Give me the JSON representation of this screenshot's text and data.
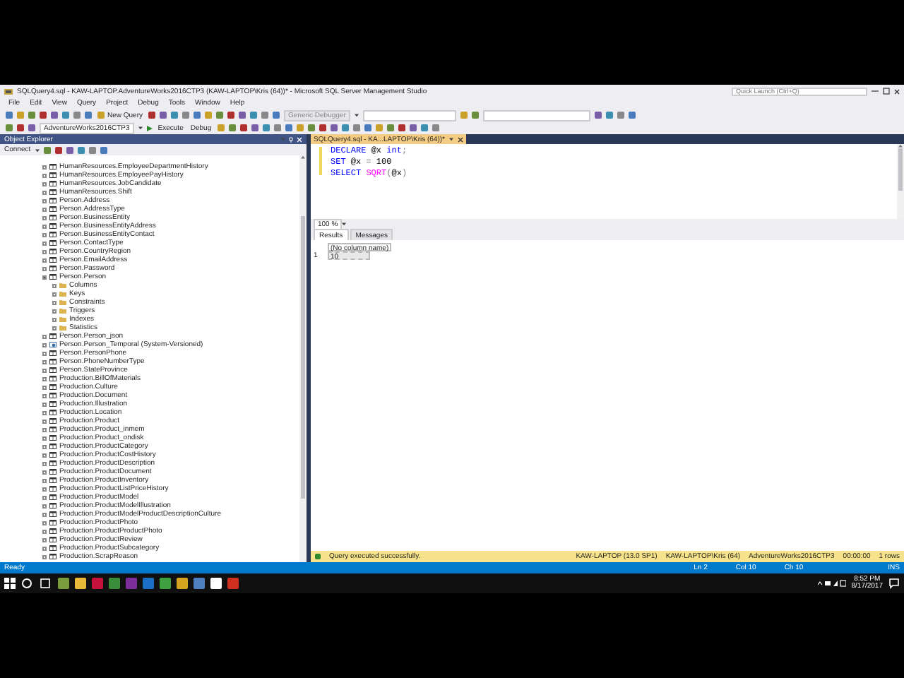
{
  "window": {
    "title": "SQLQuery4.sql - KAW-LAPTOP.AdventureWorks2016CTP3 (KAW-LAPTOP\\Kris (64))* - Microsoft SQL Server Management Studio",
    "quick_launch": {
      "placeholder": "Quick Launch (Ctrl+Q)"
    }
  },
  "menu": [
    "File",
    "Edit",
    "View",
    "Query",
    "Project",
    "Debug",
    "Tools",
    "Window",
    "Help"
  ],
  "toolbar": {
    "new_query": "New Query",
    "database": "AdventureWorks2016CTP3",
    "execute": "Execute",
    "debug": "Debug",
    "debugger": "Generic Debugger"
  },
  "object_explorer": {
    "title": "Object Explorer",
    "connect": "Connect",
    "tree": [
      {
        "label": "HumanResources.EmployeeDepartmentHistory",
        "kind": "table",
        "expanded": false
      },
      {
        "label": "HumanResources.EmployeePayHistory",
        "kind": "table",
        "expanded": false
      },
      {
        "label": "HumanResources.JobCandidate",
        "kind": "table",
        "expanded": false
      },
      {
        "label": "HumanResources.Shift",
        "kind": "table",
        "expanded": false
      },
      {
        "label": "Person.Address",
        "kind": "table",
        "expanded": false
      },
      {
        "label": "Person.AddressType",
        "kind": "table",
        "expanded": false
      },
      {
        "label": "Person.BusinessEntity",
        "kind": "table",
        "expanded": false
      },
      {
        "label": "Person.BusinessEntityAddress",
        "kind": "table",
        "expanded": false
      },
      {
        "label": "Person.BusinessEntityContact",
        "kind": "table",
        "expanded": false
      },
      {
        "label": "Person.ContactType",
        "kind": "table",
        "expanded": false
      },
      {
        "label": "Person.CountryRegion",
        "kind": "table",
        "expanded": false
      },
      {
        "label": "Person.EmailAddress",
        "kind": "table",
        "expanded": false
      },
      {
        "label": "Person.Password",
        "kind": "table",
        "expanded": false
      },
      {
        "label": "Person.Person",
        "kind": "table",
        "expanded": true,
        "children": [
          {
            "label": "Columns",
            "kind": "folder",
            "expanded": false
          },
          {
            "label": "Keys",
            "kind": "folder",
            "expanded": false
          },
          {
            "label": "Constraints",
            "kind": "folder",
            "expanded": false
          },
          {
            "label": "Triggers",
            "kind": "folder",
            "expanded": false
          },
          {
            "label": "Indexes",
            "kind": "folder",
            "expanded": false
          },
          {
            "label": "Statistics",
            "kind": "folder",
            "expanded": false
          }
        ]
      },
      {
        "label": "Person.Person_json",
        "kind": "table",
        "expanded": false
      },
      {
        "label": "Person.Person_Temporal (System-Versioned)",
        "kind": "temporal",
        "expanded": false
      },
      {
        "label": "Person.PersonPhone",
        "kind": "table",
        "expanded": false
      },
      {
        "label": "Person.PhoneNumberType",
        "kind": "table",
        "expanded": false
      },
      {
        "label": "Person.StateProvince",
        "kind": "table",
        "expanded": false
      },
      {
        "label": "Production.BillOfMaterials",
        "kind": "table",
        "expanded": false
      },
      {
        "label": "Production.Culture",
        "kind": "table",
        "expanded": false
      },
      {
        "label": "Production.Document",
        "kind": "table",
        "expanded": false
      },
      {
        "label": "Production.Illustration",
        "kind": "table",
        "expanded": false
      },
      {
        "label": "Production.Location",
        "kind": "table",
        "expanded": false
      },
      {
        "label": "Production.Product",
        "kind": "table",
        "expanded": false
      },
      {
        "label": "Production.Product_inmem",
        "kind": "table",
        "expanded": false
      },
      {
        "label": "Production.Product_ondisk",
        "kind": "table",
        "expanded": false
      },
      {
        "label": "Production.ProductCategory",
        "kind": "table",
        "expanded": false
      },
      {
        "label": "Production.ProductCostHistory",
        "kind": "table",
        "expanded": false
      },
      {
        "label": "Production.ProductDescription",
        "kind": "table",
        "expanded": false
      },
      {
        "label": "Production.ProductDocument",
        "kind": "table",
        "expanded": false
      },
      {
        "label": "Production.ProductInventory",
        "kind": "table",
        "expanded": false
      },
      {
        "label": "Production.ProductListPriceHistory",
        "kind": "table",
        "expanded": false
      },
      {
        "label": "Production.ProductModel",
        "kind": "table",
        "expanded": false
      },
      {
        "label": "Production.ProductModelIllustration",
        "kind": "table",
        "expanded": false
      },
      {
        "label": "Production.ProductModelProductDescriptionCulture",
        "kind": "table",
        "expanded": false
      },
      {
        "label": "Production.ProductPhoto",
        "kind": "table",
        "expanded": false
      },
      {
        "label": "Production.ProductProductPhoto",
        "kind": "table",
        "expanded": false
      },
      {
        "label": "Production.ProductReview",
        "kind": "table",
        "expanded": false
      },
      {
        "label": "Production.ProductSubcategory",
        "kind": "table",
        "expanded": false
      },
      {
        "label": "Production.ScrapReason",
        "kind": "table",
        "expanded": false
      }
    ]
  },
  "editor": {
    "tab": {
      "label": "SQLQuery4.sql - KA...LAPTOP\\Kris (64))*",
      "selected": true
    },
    "lines": [
      [
        {
          "text": "DECLARE",
          "kind": "keyword"
        },
        {
          "text": " @x ",
          "kind": "plain"
        },
        {
          "text": "int",
          "kind": "keyword"
        },
        {
          "text": ";",
          "kind": "operator"
        }
      ],
      [
        {
          "text": "SET",
          "kind": "keyword"
        },
        {
          "text": " @x ",
          "kind": "plain"
        },
        {
          "text": "=",
          "kind": "operator"
        },
        {
          "text": " 100",
          "kind": "plain"
        }
      ],
      [
        {
          "text": "SELECT",
          "kind": "keyword"
        },
        {
          "text": " SQRT",
          "kind": "function"
        },
        {
          "text": "(",
          "kind": "operator"
        },
        {
          "text": "@x",
          "kind": "plain"
        },
        {
          "text": ")",
          "kind": "operator"
        }
      ]
    ],
    "zoom": "100 %"
  },
  "results": {
    "tabs": [
      {
        "label": "Results",
        "selected": true
      },
      {
        "label": "Messages",
        "selected": false
      }
    ],
    "columns": [
      "(No column name)"
    ],
    "rows": [
      {
        "number": "1",
        "cells": [
          "10"
        ]
      }
    ]
  },
  "query_status": {
    "message": "Query executed successfully.",
    "server": "KAW-LAPTOP (13.0 SP1)",
    "user": "KAW-LAPTOP\\Kris (64)",
    "database": "AdventureWorks2016CTP3",
    "elapsed": "00:00:00",
    "rows": "1 rows"
  },
  "status_bar": {
    "state": "Ready",
    "line": "Ln 2",
    "column": "Col 10",
    "char": "Ch 10",
    "mode": "INS"
  },
  "taskbar": {
    "time": "8:52 PM",
    "date": "8/17/2017"
  }
}
